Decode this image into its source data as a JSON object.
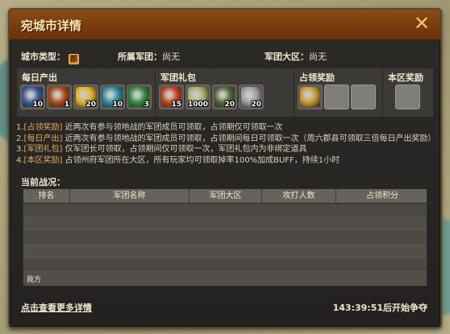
{
  "window": {
    "title": "宛城市详情",
    "close_glyph": "✕"
  },
  "info": {
    "city_type_label": "城市类型：",
    "city_type_badge": "郡",
    "legion_label": "所属军团：",
    "legion_value": "尚无",
    "region_label": "军团大区：",
    "region_value": "尚无"
  },
  "rewards": {
    "daily_label": "每日产出",
    "daily_items": [
      {
        "icon": "blue-crystal-icon",
        "count": "10",
        "color": "#3a5c9a"
      },
      {
        "icon": "treasure-chest-icon",
        "count": "1",
        "color": "#b04a14"
      },
      {
        "icon": "gold-ingot-icon",
        "count": "20",
        "color": "#e6b31e"
      },
      {
        "icon": "teal-gem-icon",
        "count": "10",
        "color": "#2b8fa3"
      },
      {
        "icon": "green-jade-icon",
        "count": "3",
        "color": "#2f8f3c"
      }
    ],
    "gift_label": "军团礼包",
    "gift_items": [
      {
        "icon": "fire-orb-icon",
        "count": "15",
        "color": "#c8421a"
      },
      {
        "icon": "grain-sack-icon",
        "count": "1000",
        "color": "#a9b06a"
      },
      {
        "icon": "herb-bundle-icon",
        "count": "20",
        "color": "#4f6a3a"
      },
      {
        "icon": "armor-piece-icon",
        "count": "20",
        "color": "#9aa0a4"
      }
    ],
    "occupy_label": "占领奖励",
    "occupy_items": [
      {
        "icon": "gold-medal-icon",
        "count": "",
        "color": "#c99a2e"
      }
    ],
    "region_label": "本区奖励"
  },
  "descriptions": [
    {
      "num": "1.",
      "tag": "[占领奖励]",
      "text": "近两次有参与领地战的军团成员可领取，占领期仅可领取一次"
    },
    {
      "num": "2.",
      "tag": "[每日产出]",
      "text": "近两次有参与领地战的军团成员可领取，占领期间每日可领取一次（周六郡县可领取三倍每日产出奖励）"
    },
    {
      "num": "3.",
      "tag": "[军团礼包]",
      "text": "仅军团长可领取，占领期间仅可领取一次，军团礼包内为非绑定道具"
    },
    {
      "num": "4.",
      "tag": "[本区奖励]",
      "text": "占领州府军团所在大区，所有玩家均可领取掉率100%加成BUFF，持续1小时"
    }
  ],
  "status": {
    "title": "当前战况：",
    "columns": [
      "排名",
      "军团名称",
      "军团大区",
      "攻打人数",
      "占领积分"
    ],
    "me_label": "我方"
  },
  "footer": {
    "more_link": "点击查看更多详情",
    "countdown": "143:39:51后开始争夺"
  }
}
